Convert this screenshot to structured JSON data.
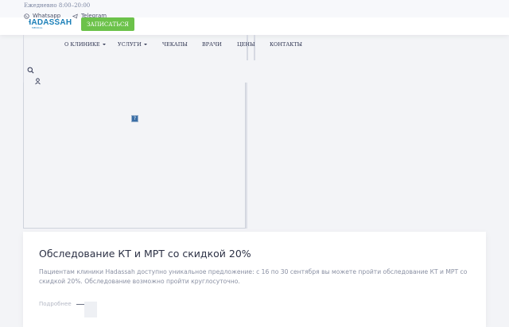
{
  "topbar": {
    "hours": "Ежедневно 8:00–20:00",
    "whatsapp_label": "Whatsapp",
    "telegram_label": "Telegram"
  },
  "logo": {
    "name": "HADASSAH",
    "subtitle": "MEDICAL",
    "color": "#1a7fb8"
  },
  "header": {
    "cta_label": "ЗАПИСАТЬСЯ",
    "cta_color": "#6cc24a"
  },
  "nav": {
    "items": [
      {
        "label": "О КЛИНИКЕ",
        "dropdown": true
      },
      {
        "label": "УСЛУГИ",
        "dropdown": true
      },
      {
        "label": "ЧЕКАПЫ",
        "dropdown": false
      },
      {
        "label": "ВРАЧИ",
        "dropdown": false
      },
      {
        "label": "ЦЕНЫ",
        "dropdown": false
      },
      {
        "label": "КОНТАКТЫ",
        "dropdown": false
      }
    ]
  },
  "icons": {
    "search": "search-icon",
    "user": "user-icon",
    "whatsapp": "whatsapp-icon",
    "telegram": "telegram-icon",
    "broken_image": "broken-image-icon"
  },
  "promo": {
    "title": "Обследование КТ и МРТ со скидкой 20%",
    "text": "Пациентам клиники Hadassah доступно уникальное предложение: с 16 по 30 сентября вы можете пройти обследование КТ и МРТ со скидкой 20%. Обследование возможно пройти круглосуточно.",
    "more_label": "Подробнее"
  }
}
